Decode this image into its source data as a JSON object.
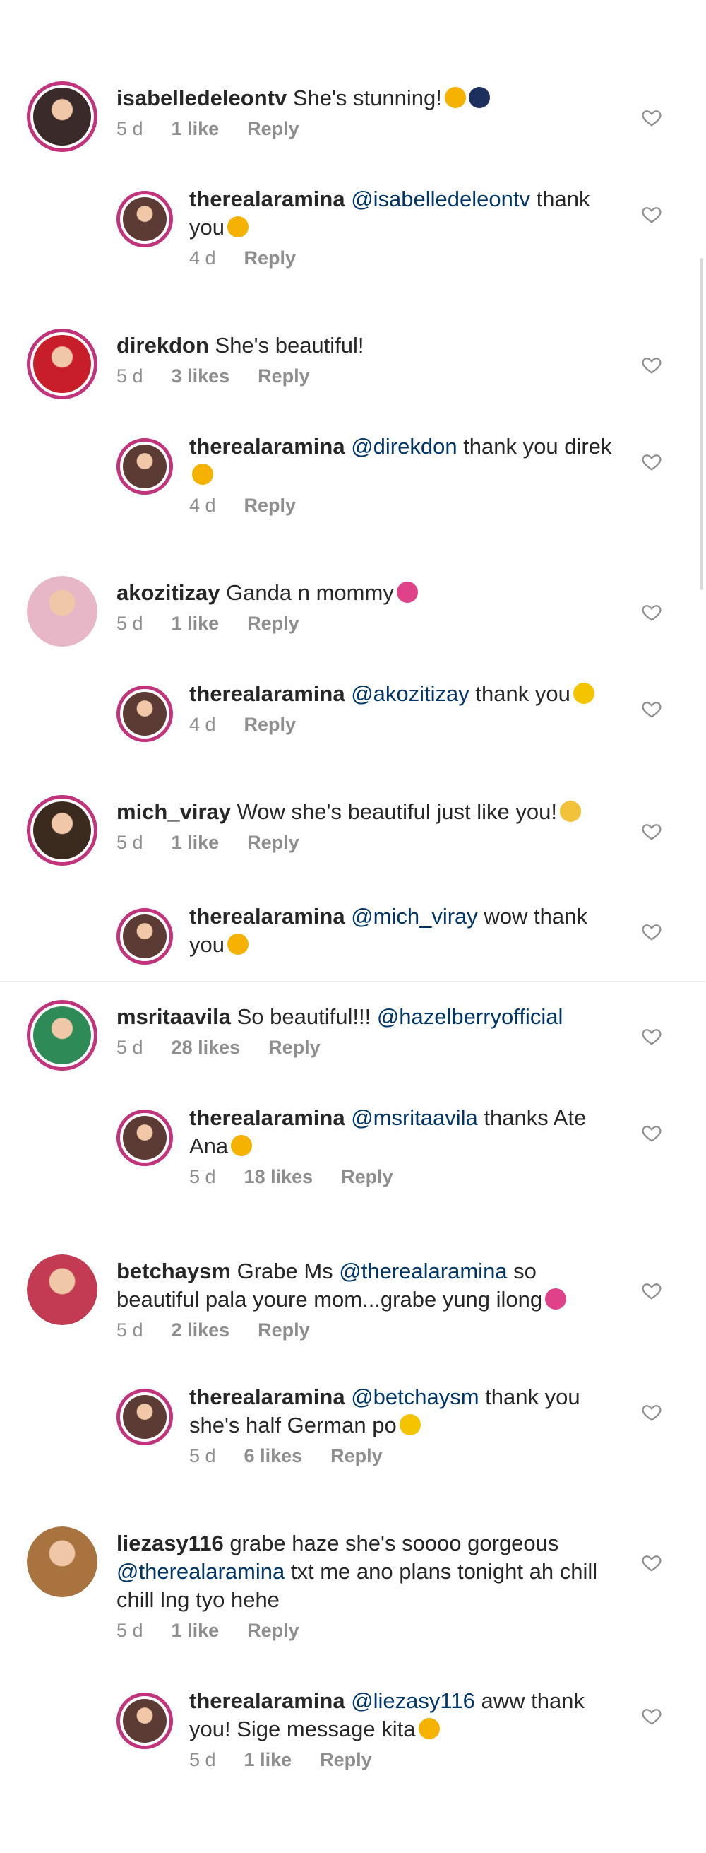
{
  "comments": [
    {
      "user": "isabelledeleontv",
      "pre": " She's stunning!",
      "mention": "",
      "post": "",
      "emoji": "😍🌌",
      "time": "5 d",
      "likes": "1 like",
      "reply": "Reply"
    },
    {
      "user": "therealaramina",
      "pre": " ",
      "mention": "@isabelledeleontv",
      "post": " thank you",
      "emoji": "😍",
      "time": "4 d",
      "likes": "",
      "reply": "Reply"
    },
    {
      "user": "direkdon",
      "pre": " She's beautiful!",
      "mention": "",
      "post": "",
      "emoji": "",
      "time": "5 d",
      "likes": "3 likes",
      "reply": "Reply"
    },
    {
      "user": "therealaramina",
      "pre": " ",
      "mention": "@direkdon",
      "post": " thank you direk",
      "emoji": "😍",
      "time": "4 d",
      "likes": "",
      "reply": "Reply"
    },
    {
      "user": "akozitizay",
      "pre": " Ganda n mommy",
      "mention": "",
      "post": "",
      "emoji": "💕",
      "time": "5 d",
      "likes": "1 like",
      "reply": "Reply"
    },
    {
      "user": "therealaramina",
      "pre": " ",
      "mention": "@akozitizay",
      "post": " thank you",
      "emoji": "🙂",
      "time": "4 d",
      "likes": "",
      "reply": "Reply"
    },
    {
      "user": "mich_viray",
      "pre": " Wow she's beautiful just like you!",
      "mention": "",
      "post": "",
      "emoji": "🙏",
      "time": "5 d",
      "likes": "1 like",
      "reply": "Reply"
    },
    {
      "user": "therealaramina",
      "pre": " ",
      "mention": "@mich_viray",
      "post": " wow thank you",
      "emoji": "😍",
      "time": "",
      "likes": "",
      "reply": ""
    },
    {
      "user": "msritaavila",
      "pre": " So beautiful!!! ",
      "mention": "@hazelberryofficial",
      "post": "",
      "emoji": "",
      "time": "5 d",
      "likes": "28 likes",
      "reply": "Reply"
    },
    {
      "user": "therealaramina",
      "pre": " ",
      "mention": "@msritaavila",
      "post": " thanks Ate Ana",
      "emoji": "😘",
      "time": "5 d",
      "likes": "18 likes",
      "reply": "Reply"
    },
    {
      "user": "betchaysm",
      "pre": " Grabe Ms ",
      "mention": "@therealaramina",
      "post": " so beautiful pala youre mom...grabe yung ilong",
      "emoji": "💕",
      "time": "5 d",
      "likes": "2 likes",
      "reply": "Reply"
    },
    {
      "user": "therealaramina",
      "pre": " ",
      "mention": "@betchaysm",
      "post": " thank you she's half German po",
      "emoji": "😊",
      "time": "5 d",
      "likes": "6 likes",
      "reply": "Reply"
    },
    {
      "user": "liezasy116",
      "pre": " grabe haze she's soooo gorgeous ",
      "mention": "@therealaramina",
      "post": " txt me ano plans tonight ah chill chill lng tyo hehe",
      "emoji": "",
      "time": "5 d",
      "likes": "1 like",
      "reply": "Reply"
    },
    {
      "user": "therealaramina",
      "pre": " ",
      "mention": "@liezasy116",
      "post": " aww thank you! Sige message kita",
      "emoji": "😘",
      "time": "5 d",
      "likes": "1 like",
      "reply": "Reply"
    }
  ],
  "colors": {
    "ring": "#c1337a",
    "mention": "#003569",
    "meta": "#8e8e8e",
    "text": "#262626"
  },
  "icons": {
    "like": "heart-outline-icon"
  }
}
